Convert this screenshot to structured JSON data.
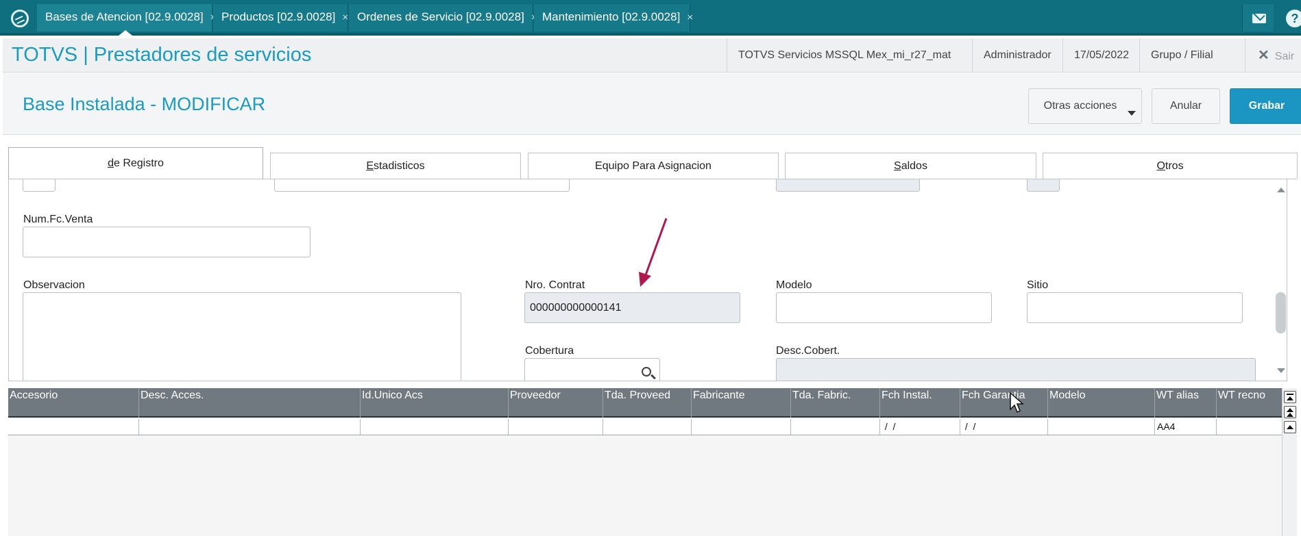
{
  "top_tabs": [
    {
      "label": "Bases de Atencion [02.9.0028]",
      "close": "×"
    },
    {
      "label": "Productos [02.9.0028]",
      "close": "×"
    },
    {
      "label": "Ordenes de Servicio [02.9.0028]",
      "close": "×"
    },
    {
      "label": "Mantenimiento [02.9.0028]",
      "close": "×"
    }
  ],
  "header": {
    "app_title": "TOTVS | Prestadores de servicios",
    "environment": "TOTVS Servicios MSSQL Mex_mi_r27_mat",
    "user": "Administrador",
    "date": "17/05/2022",
    "branch": "Grupo / Filial",
    "exit_label": "Sair"
  },
  "page": {
    "title": "Base Instalada - MODIFICAR",
    "actions": {
      "more": "Otras acciones",
      "cancel": "Anular",
      "save": "Grabar"
    }
  },
  "form_tabs": [
    {
      "key": "d",
      "rest": "e Registro",
      "active": true
    },
    {
      "key": "E",
      "rest": "stadisticos"
    },
    {
      "key": "",
      "rest": "Equipo Para Asignacion"
    },
    {
      "key": "S",
      "rest": "aldos"
    },
    {
      "key": "O",
      "rest": "tros"
    }
  ],
  "fields": {
    "num_fc_venta": {
      "label": "Num.Fc.Venta",
      "value": ""
    },
    "observacion": {
      "label": "Observacion",
      "value": ""
    },
    "nro_contrat": {
      "label": "Nro. Contrat",
      "value": "000000000000141"
    },
    "modelo": {
      "label": "Modelo",
      "value": ""
    },
    "sitio": {
      "label": "Sitio",
      "value": ""
    },
    "cobertura": {
      "label": "Cobertura",
      "value": ""
    },
    "desc_cobert": {
      "label": "Desc.Cobert.",
      "value": ""
    }
  },
  "grid": {
    "columns": [
      "Accesorio",
      "Desc. Acces.",
      "Id.Unico Acs",
      "Proveedor",
      "Tda. Proveed",
      "Fabricante",
      "Tda. Fabric.",
      "Fch Instal.",
      "Fch Garantia",
      "Modelo",
      "WT alias",
      "WT recno"
    ],
    "rows": [
      [
        "",
        "",
        "",
        "",
        "",
        "",
        "",
        " /  /",
        " /  /",
        "",
        "AA4",
        ""
      ]
    ]
  },
  "colors": {
    "topbar": "#0f6f7f",
    "accent": "#1b9bbf",
    "primary_button": "#1b95c2",
    "annotation_arrow": "#b0174f"
  }
}
